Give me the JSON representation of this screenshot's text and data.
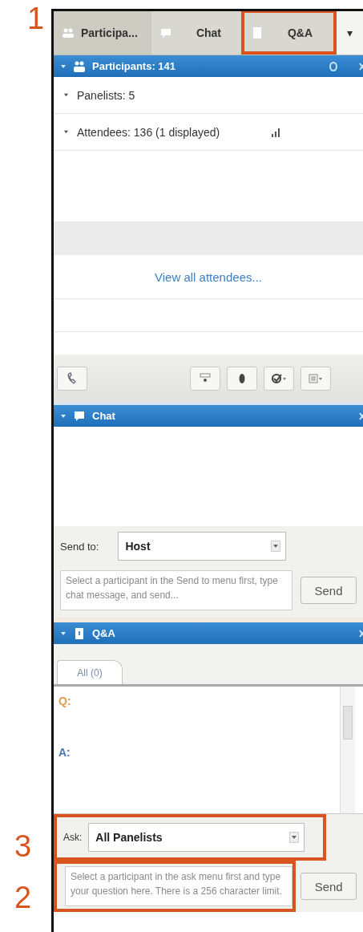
{
  "tabs": [
    {
      "label": "Participa...",
      "selected": true
    },
    {
      "label": "Chat",
      "selected": false
    },
    {
      "label": "Q&A",
      "selected": false
    }
  ],
  "tab_menu": "▾",
  "participants": {
    "title": "Participants: 141",
    "expanded": true,
    "groups": [
      {
        "label": "Panelists: 5",
        "expanded": false,
        "signal": false
      },
      {
        "label": "Attendees: 136 (1 displayed)",
        "expanded": false,
        "signal": true
      }
    ],
    "link": "View all attendees..."
  },
  "chat": {
    "title": "Chat",
    "expanded": true,
    "send_to_label": "Send to:",
    "send_to": "Host",
    "placeholder": "Select a participant in the Send to menu first, type chat message, and send...",
    "send": "Send"
  },
  "qa": {
    "title": "Q&A",
    "expanded": true,
    "tabs": [
      {
        "label": "All (0)",
        "selected": true
      }
    ],
    "q_label": "Q:",
    "a_label": "A:",
    "ask_label": "Ask:",
    "ask": "All Panelists",
    "placeholder": "Select a participant in the ask menu first and type your question here. There is a 256 character limit.",
    "send": "Send"
  },
  "callouts": [
    {
      "number": "1"
    },
    {
      "number": "3"
    },
    {
      "number": "2"
    }
  ]
}
